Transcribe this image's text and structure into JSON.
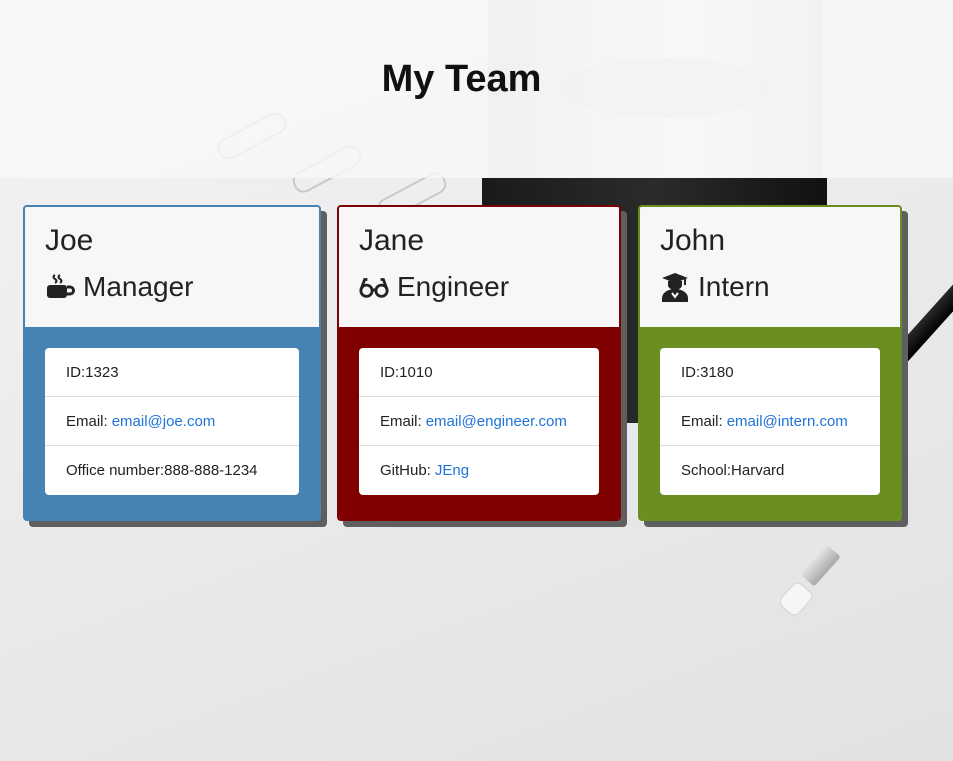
{
  "page": {
    "title": "My Team"
  },
  "team": [
    {
      "role_key": "manager",
      "name": "Joe",
      "role": "Manager",
      "icon": "coffee-icon",
      "accent": "#4682b4",
      "items": [
        {
          "label": "ID: ",
          "value": "1323"
        },
        {
          "label": "Email: ",
          "link": "email@joe.com"
        },
        {
          "label": "Office number: ",
          "value": "888-888-1234"
        }
      ]
    },
    {
      "role_key": "engineer",
      "name": "Jane",
      "role": "Engineer",
      "icon": "glasses-icon",
      "accent": "#800000",
      "items": [
        {
          "label": "ID: ",
          "value": "1010"
        },
        {
          "label": "Email: ",
          "link": "email@engineer.com"
        },
        {
          "label": "GitHub: ",
          "link": "JEng"
        }
      ]
    },
    {
      "role_key": "intern",
      "name": "John",
      "role": "Intern",
      "icon": "graduate-icon",
      "accent": "#6b8e23",
      "items": [
        {
          "label": "ID: ",
          "value": "3180"
        },
        {
          "label": "Email: ",
          "link": "email@intern.com"
        },
        {
          "label": "School: ",
          "value": "Harvard"
        }
      ]
    }
  ]
}
